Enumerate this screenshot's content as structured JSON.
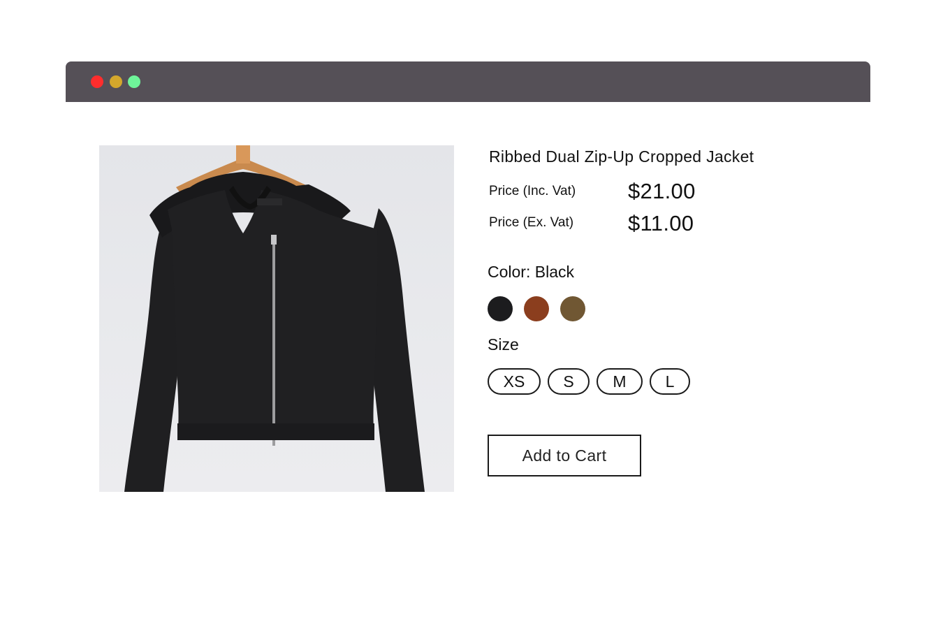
{
  "window": {
    "controls": [
      {
        "name": "close",
        "color": "#ff2d2d"
      },
      {
        "name": "minimize",
        "color": "#d4a72c"
      },
      {
        "name": "maximize",
        "color": "#6ff59a"
      }
    ]
  },
  "product": {
    "title": "Ribbed Dual Zip-Up Cropped Jacket",
    "image_icon": "jacket-on-hanger-image",
    "price_inc_label": "Price (Inc. Vat)",
    "price_inc_value": "$21.00",
    "price_ex_label": "Price (Ex. Vat)",
    "price_ex_value": "$11.00",
    "color_label": "Color: Black",
    "colors": [
      {
        "name": "Black",
        "hex": "#1c1c1e"
      },
      {
        "name": "Rust",
        "hex": "#8b3e1e"
      },
      {
        "name": "Olive Brown",
        "hex": "#705733"
      }
    ],
    "size_label": "Size",
    "sizes": [
      "XS",
      "S",
      "M",
      "L"
    ],
    "add_to_cart_label": "Add to Cart"
  }
}
